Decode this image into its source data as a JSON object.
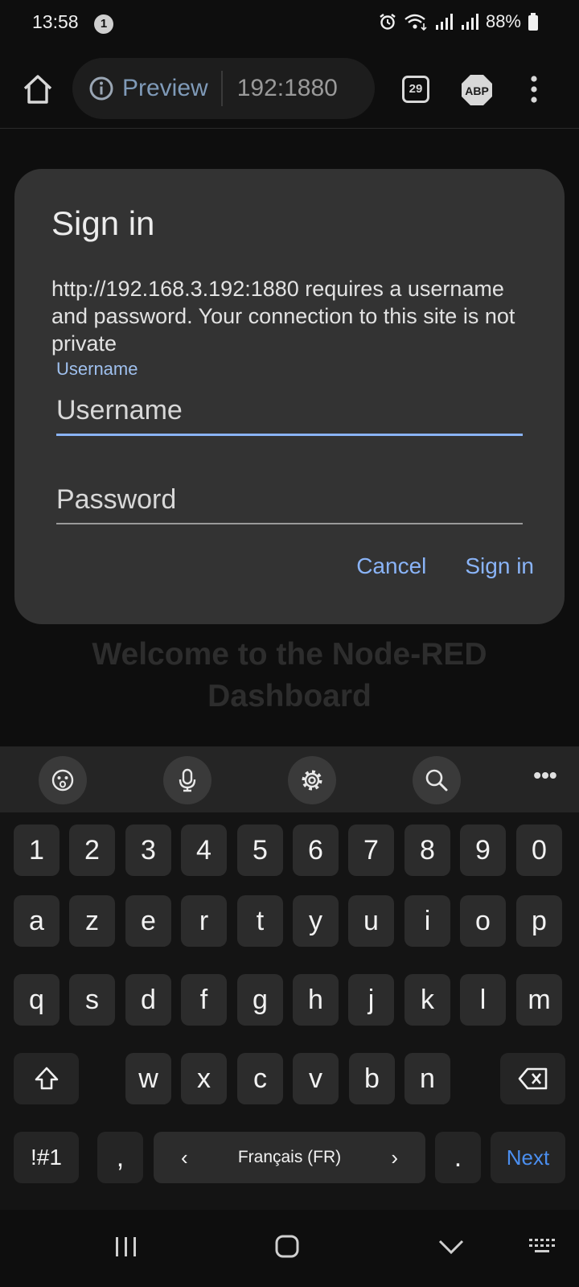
{
  "status_bar": {
    "time": "13:58",
    "notification_count": "1",
    "battery": "88%"
  },
  "toolbar": {
    "preview_label": "Preview",
    "url": "192:1880",
    "tab_count": "29",
    "adblock_label": "ABP"
  },
  "page": {
    "heading": "Welcome to the Node-RED Dashboard"
  },
  "dialog": {
    "title": "Sign in",
    "message": "http://192.168.3.192:1880 requires a username and password. Your connection to this site is not private",
    "username_label": "Username",
    "username_placeholder": "Username",
    "password_placeholder": "Password",
    "cancel_label": "Cancel",
    "signin_label": "Sign in"
  },
  "keyboard": {
    "row_numbers": [
      "1",
      "2",
      "3",
      "4",
      "5",
      "6",
      "7",
      "8",
      "9",
      "0"
    ],
    "row_1": [
      "a",
      "z",
      "e",
      "r",
      "t",
      "y",
      "u",
      "i",
      "o",
      "p"
    ],
    "row_2": [
      "q",
      "s",
      "d",
      "f",
      "g",
      "h",
      "j",
      "k",
      "l",
      "m"
    ],
    "row_3": [
      "w",
      "x",
      "c",
      "v",
      "b",
      "n"
    ],
    "symbols_label": "!#1",
    "comma": ",",
    "language": "Français (FR)",
    "period": ".",
    "next_label": "Next"
  },
  "colors": {
    "accent": "#8ab4f8",
    "dialog_bg": "#333333",
    "key_bg": "#2c2c2c",
    "next_key": "#4b8ff0"
  }
}
